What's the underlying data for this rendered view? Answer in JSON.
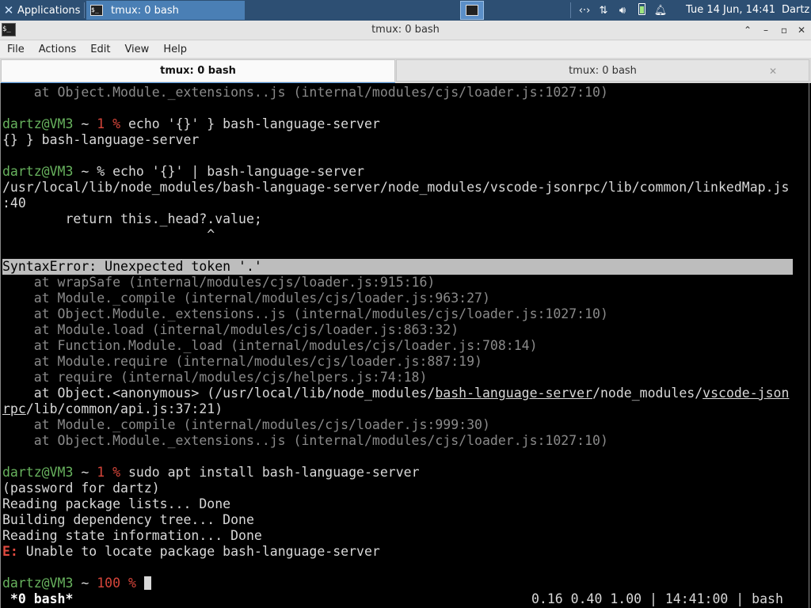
{
  "panel": {
    "apps_label": "Applications",
    "task_label": "tmux: 0 bash",
    "clock": "Tue 14 Jun, 14:41",
    "user": "Dartz"
  },
  "window": {
    "title": "tmux: 0 bash",
    "btn_up": "⌃",
    "btn_min": "–",
    "btn_max": "▫",
    "btn_close": "✕"
  },
  "menu": {
    "file": "File",
    "actions": "Actions",
    "edit": "Edit",
    "view": "View",
    "help": "Help"
  },
  "tabs": {
    "active": "tmux: 0 bash",
    "inactive": "tmux: 0 bash",
    "close": "✕"
  },
  "terminal": {
    "l0": "    at Object.Module._extensions..js (internal/modules/cjs/loader.js:1027:10)",
    "user_host": "dartz@VM3",
    "tilde": " ~ ",
    "code1": "1 %",
    "code100": "100 %",
    "pct": "%",
    "cmd1": " echo '{}' } bash-language-server",
    "out1": "{} } bash-language-server",
    "cmd2": " echo '{}' | bash-language-server",
    "path1": "/usr/local/lib/node_modules/bash-language-server/node_modules/vscode-jsonrpc/lib/common/linkedMap.js",
    "path1b": ":40",
    "code_line": "        return this._head?.value;",
    "caret": "                          ^",
    "error": "SyntaxError: Unexpected token '.'",
    "s1": "    at wrapSafe (internal/modules/cjs/loader.js:915:16)",
    "s2": "    at Module._compile (internal/modules/cjs/loader.js:963:27)",
    "s3": "    at Object.Module._extensions..js (internal/modules/cjs/loader.js:1027:10)",
    "s4": "    at Module.load (internal/modules/cjs/loader.js:863:32)",
    "s5": "    at Function.Module._load (internal/modules/cjs/loader.js:708:14)",
    "s6": "    at Module.require (internal/modules/cjs/loader.js:887:19)",
    "s7": "    at require (internal/modules/cjs/helpers.js:74:18)",
    "s8a": "    at Object.<anonymous> (/usr/local/lib/node_modules/",
    "s8b": "bash-language-server",
    "s8c": "/node_modules/",
    "s8d": "vscode-json",
    "s9a": "rpc",
    "s9b": "/lib/common/api.js:37:21)",
    "s10": "    at Module._compile (internal/modules/cjs/loader.js:999:30)",
    "s11": "    at Object.Module._extensions..js (internal/modules/cjs/loader.js:1027:10)",
    "cmd3": " sudo apt install bash-language-server",
    "o1": "(password for dartz)",
    "o2": "Reading package lists... Done",
    "o3": "Building dependency tree... Done",
    "o4": "Reading state information... Done",
    "e_label": "E:",
    "e_text": " Unable to locate package bash-language-server",
    "status_left": " *0 bash*",
    "status_right": "0.16 0.40 1.00 | 14:41:00 | bash"
  }
}
